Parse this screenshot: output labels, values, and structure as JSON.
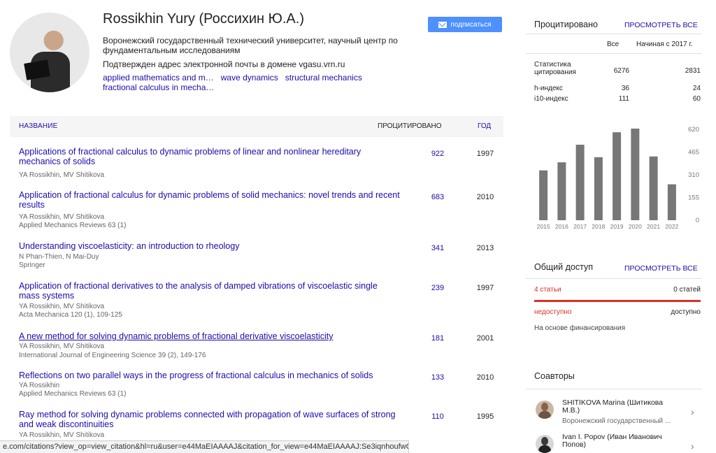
{
  "profile": {
    "name": "Rossikhin Yury (Россихин Ю.А.)",
    "affiliation": "Воронежский государственный технический университет, научный центр по фундаментальным исследованиям",
    "verified": "Подтвержден адрес электронной почты в домене vgasu.vrn.ru",
    "interests": [
      "applied mathematics and m…",
      "wave dynamics",
      "structural mechanics",
      "fractional calculus in mecha…"
    ],
    "follow_label": "подписаться"
  },
  "table": {
    "col_title": "НАЗВАНИЕ",
    "col_cited": "ПРОЦИТИРОВАНО",
    "col_year": "ГОД",
    "rows": [
      {
        "title": "Applications of fractional calculus to dynamic problems of linear and nonlinear hereditary mechanics of solids",
        "authors": "YA Rossikhin, MV Shitikova",
        "venue": "",
        "cited": "922",
        "year": "1997"
      },
      {
        "title": "Application of fractional calculus for dynamic problems of solid mechanics: novel trends and recent results",
        "authors": "YA Rossikhin, MV Shitikova",
        "venue": "Applied Mechanics Reviews 63 (1)",
        "cited": "683",
        "year": "2010"
      },
      {
        "title": "Understanding viscoelasticity: an introduction to rheology",
        "authors": "N Phan-Thien, N Mai-Duy",
        "venue": "Springer",
        "cited": "341",
        "year": "2013"
      },
      {
        "title": "Application of fractional derivatives to the analysis of damped vibrations of viscoelastic single mass systems",
        "authors": "YA Rossikhin, MV Shitikova",
        "venue": "Acta Mechanica 120 (1), 109-125",
        "cited": "239",
        "year": "1997"
      },
      {
        "title": "A new method for solving dynamic problems of fractional derivative viscoelasticity",
        "authors": "YA Rossikhin, MV Shitikova",
        "venue": "International Journal of Engineering Science 39 (2), 149-176",
        "cited": "181",
        "year": "2001"
      },
      {
        "title": "Reflections on two parallel ways in the progress of fractional calculus in mechanics of solids",
        "authors": "YA Rossikhin",
        "venue": "Applied Mechanics Reviews 63 (1)",
        "cited": "133",
        "year": "2010"
      },
      {
        "title": "Ray method for solving dynamic problems connected with propagation of wave surfaces of strong and weak discontinuities",
        "authors": "YA Rossikhin, MV Shitikova",
        "venue": "",
        "cited": "110",
        "year": "1995"
      }
    ]
  },
  "cited_panel": {
    "title": "Процитировано",
    "view_all": "ПРОСМОТРЕТЬ ВСЕ",
    "col_all": "Все",
    "col_since": "Начиная с 2017 г.",
    "rows": [
      {
        "label": "Статистика цитирования",
        "all": "6276",
        "since": "2831"
      },
      {
        "label": "h-индекс",
        "all": "36",
        "since": "24"
      },
      {
        "label": "i10-индекс",
        "all": "111",
        "since": "60"
      }
    ]
  },
  "chart_data": {
    "type": "bar",
    "categories": [
      "2015",
      "2016",
      "2017",
      "2018",
      "2019",
      "2020",
      "2021",
      "2022"
    ],
    "values": [
      340,
      395,
      515,
      430,
      600,
      625,
      435,
      245
    ],
    "ylim": [
      0,
      620
    ],
    "yticks": [
      "620",
      "465",
      "310",
      "155",
      "0"
    ],
    "bar_color": "#777777"
  },
  "access": {
    "title": "Общий доступ",
    "view_all": "ПРОСМОТРЕТЬ ВСЕ",
    "left_count": "4 статьи",
    "right_count": "0 статей",
    "left_label": "недоступно",
    "right_label": "доступно",
    "funding": "На основе финансирования",
    "unavailable_color": "#d93025"
  },
  "coauthors": {
    "title": "Соавторы",
    "items": [
      {
        "name": "SHITIKOVA Marina (Шитикова М.В.)",
        "affiliation": "Воронежский государственный ..."
      },
      {
        "name": "Ivan I. Popov (Иван Иванович Попов)",
        "affiliation": ""
      }
    ]
  },
  "status_url": "e.com/citations?view_op=view_citation&hl=ru&user=e44MaEIAAAAJ&citation_for_view=e44MaEIAAAAJ:Se3iqnhoufwC"
}
